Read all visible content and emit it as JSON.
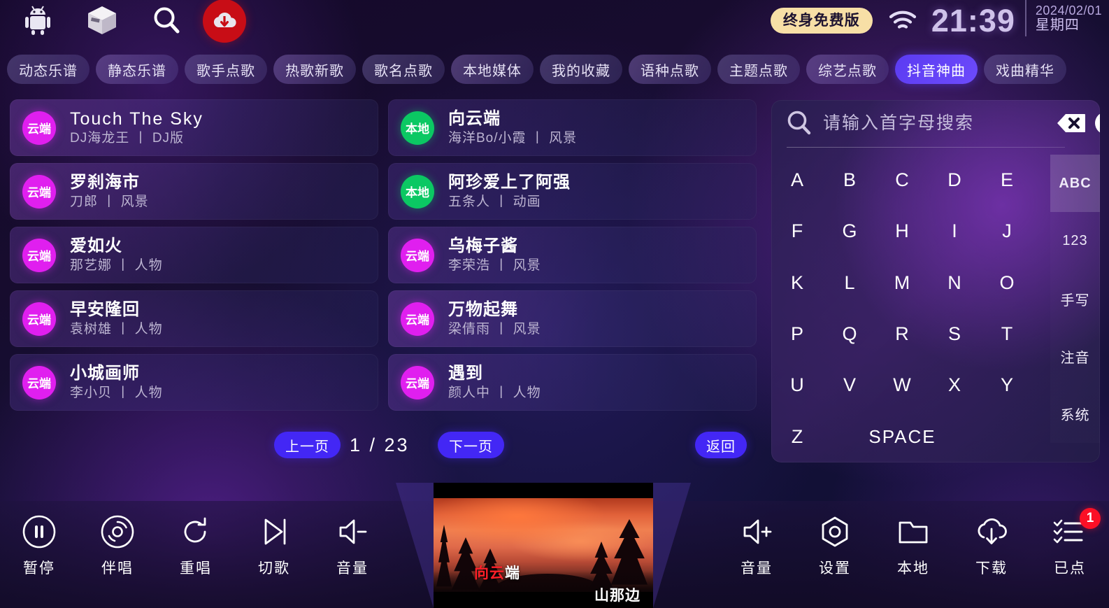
{
  "topbar": {
    "icons": [
      {
        "name": "android-icon",
        "label": "Android"
      },
      {
        "name": "box-icon",
        "label": "Apps"
      },
      {
        "name": "search-icon",
        "label": "Search"
      },
      {
        "name": "cloud-download-icon",
        "label": "Cloud Download"
      }
    ],
    "free_badge": "终身免费版",
    "wifi": "wifi-icon",
    "time": "21:39",
    "date": "2024/02/01",
    "weekday": "星期四"
  },
  "tabs": [
    {
      "label": "动态乐谱",
      "active": false
    },
    {
      "label": "静态乐谱",
      "active": false
    },
    {
      "label": "歌手点歌",
      "active": false
    },
    {
      "label": "热歌新歌",
      "active": false
    },
    {
      "label": "歌名点歌",
      "active": false
    },
    {
      "label": "本地媒体",
      "active": false
    },
    {
      "label": "我的收藏",
      "active": false
    },
    {
      "label": "语种点歌",
      "active": false
    },
    {
      "label": "主题点歌",
      "active": false
    },
    {
      "label": "综艺点歌",
      "active": false
    },
    {
      "label": "抖音神曲",
      "active": true
    },
    {
      "label": "戏曲精华",
      "active": false
    }
  ],
  "songs": {
    "left": [
      {
        "badge": "云端",
        "source": "cloud",
        "title": "Touch  The  Sky",
        "artist": "DJ海龙王",
        "category": "DJ版"
      },
      {
        "badge": "云端",
        "source": "cloud",
        "title": "罗刹海市",
        "artist": "刀郎",
        "category": "风景"
      },
      {
        "badge": "云端",
        "source": "cloud",
        "title": "爱如火",
        "artist": "那艺娜",
        "category": "人物"
      },
      {
        "badge": "云端",
        "source": "cloud",
        "title": "早安隆回",
        "artist": "袁树雄",
        "category": "人物"
      },
      {
        "badge": "云端",
        "source": "cloud",
        "title": "小城画师",
        "artist": "李小贝",
        "category": "人物"
      }
    ],
    "right": [
      {
        "badge": "本地",
        "source": "local",
        "title": "向云端",
        "artist": "海洋Bo/小霞",
        "category": "风景"
      },
      {
        "badge": "本地",
        "source": "local",
        "title": "阿珍爱上了阿强",
        "artist": "五条人",
        "category": "动画"
      },
      {
        "badge": "云端",
        "source": "cloud",
        "title": "乌梅子酱",
        "artist": "李荣浩",
        "category": "风景"
      },
      {
        "badge": "云端",
        "source": "cloud",
        "title": "万物起舞",
        "artist": "梁倩雨",
        "category": "风景"
      },
      {
        "badge": "云端",
        "source": "cloud",
        "title": "遇到",
        "artist": "颜人中",
        "category": "人物"
      }
    ],
    "separator": "丨"
  },
  "pager": {
    "prev": "上一页",
    "next": "下一页",
    "back": "返回",
    "current_page": "1",
    "total_pages": "23",
    "page_display": "1 / 23"
  },
  "search": {
    "placeholder": "请输入首字母搜索",
    "value": "",
    "icon": "search-icon",
    "backspace_icon": "backspace-icon",
    "close_icon": "close-icon"
  },
  "keyboard": {
    "keys": [
      "A",
      "B",
      "C",
      "D",
      "E",
      "F",
      "G",
      "H",
      "I",
      "J",
      "K",
      "L",
      "M",
      "N",
      "O",
      "P",
      "Q",
      "R",
      "S",
      "T",
      "U",
      "V",
      "W",
      "X",
      "Y",
      "Z"
    ],
    "space": "SPACE",
    "modes": [
      {
        "label": "ABC",
        "active": true
      },
      {
        "label": "123",
        "active": false
      },
      {
        "label": "手写",
        "active": false
      },
      {
        "label": "注音",
        "active": false
      },
      {
        "label": "系统",
        "active": false
      }
    ]
  },
  "toolbar": {
    "left": [
      {
        "label": "暂停",
        "icon": "pause-circle-icon"
      },
      {
        "label": "伴唱",
        "icon": "disc-icon"
      },
      {
        "label": "重唱",
        "icon": "replay-icon"
      },
      {
        "label": "切歌",
        "icon": "skip-next-icon"
      },
      {
        "label": "音量",
        "icon": "volume-down-icon"
      }
    ],
    "right": [
      {
        "label": "音量",
        "icon": "volume-up-icon"
      },
      {
        "label": "设置",
        "icon": "settings-nut-icon"
      },
      {
        "label": "本地",
        "icon": "folder-icon"
      },
      {
        "label": "下载",
        "icon": "cloud-download-icon"
      },
      {
        "label": "已点",
        "icon": "checklist-icon",
        "badge": "1"
      }
    ]
  },
  "video": {
    "lyric_sung": "向云",
    "lyric_pending": "端",
    "lyric_next": "山那边"
  }
}
